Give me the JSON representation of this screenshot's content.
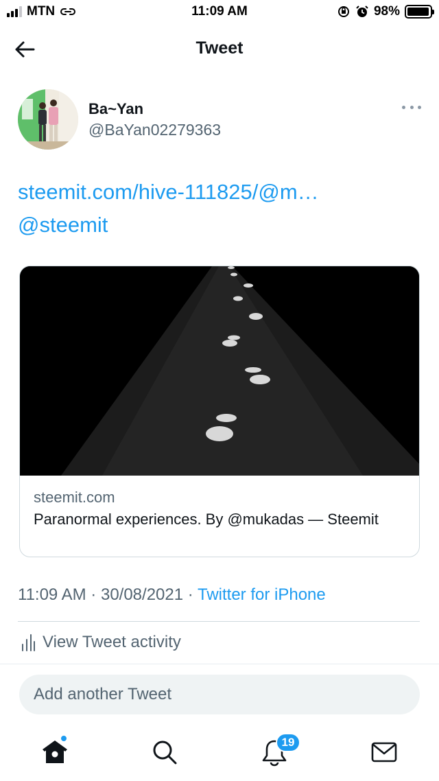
{
  "status_bar": {
    "carrier": "MTN",
    "time": "11:09 AM",
    "battery": "98%",
    "battery_level": 0.98
  },
  "header": {
    "title": "Tweet",
    "back_icon": "arrow-left-icon"
  },
  "tweet": {
    "author_name": "Ba~Yan",
    "author_handle": "@BaYan02279363",
    "link_text": "steemit.com/hive-111825/@m…",
    "mention_text": "@steemit",
    "card": {
      "domain": "steemit.com",
      "title": "Paranormal experiences. By @mukadas — Steemit"
    },
    "time": "11:09 AM",
    "date": "30/08/2021",
    "separator": "·",
    "source": "Twitter for iPhone",
    "activity_label": "View Tweet activity"
  },
  "reply": {
    "placeholder": "Add another Tweet"
  },
  "tabbar": {
    "notification_count": "19",
    "icons": [
      "home-icon",
      "search-icon",
      "bell-icon",
      "mail-icon"
    ]
  },
  "colors": {
    "accent": "#1d9bf0",
    "text": "#0f1419",
    "secondary": "#536471"
  }
}
